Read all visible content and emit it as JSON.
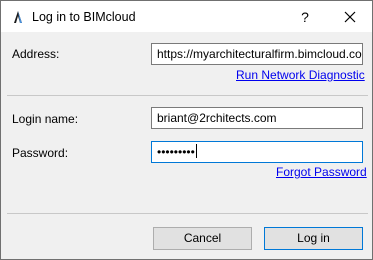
{
  "window": {
    "title": "Log in to BIMcloud",
    "help_label": "?"
  },
  "address": {
    "label": "Address:",
    "value": "https://myarchitecturalfirm.bimcloud.co",
    "diagnostic_link": "Run Network Diagnostic"
  },
  "login": {
    "name_label": "Login name:",
    "name_value": "briant@2rchitects.com",
    "password_label": "Password:",
    "password_mask": "•••••••••",
    "forgot_link": "Forgot Password"
  },
  "buttons": {
    "cancel": "Cancel",
    "login": "Log in"
  },
  "colors": {
    "link": "#0000ee",
    "focus_border": "#0078d7"
  }
}
